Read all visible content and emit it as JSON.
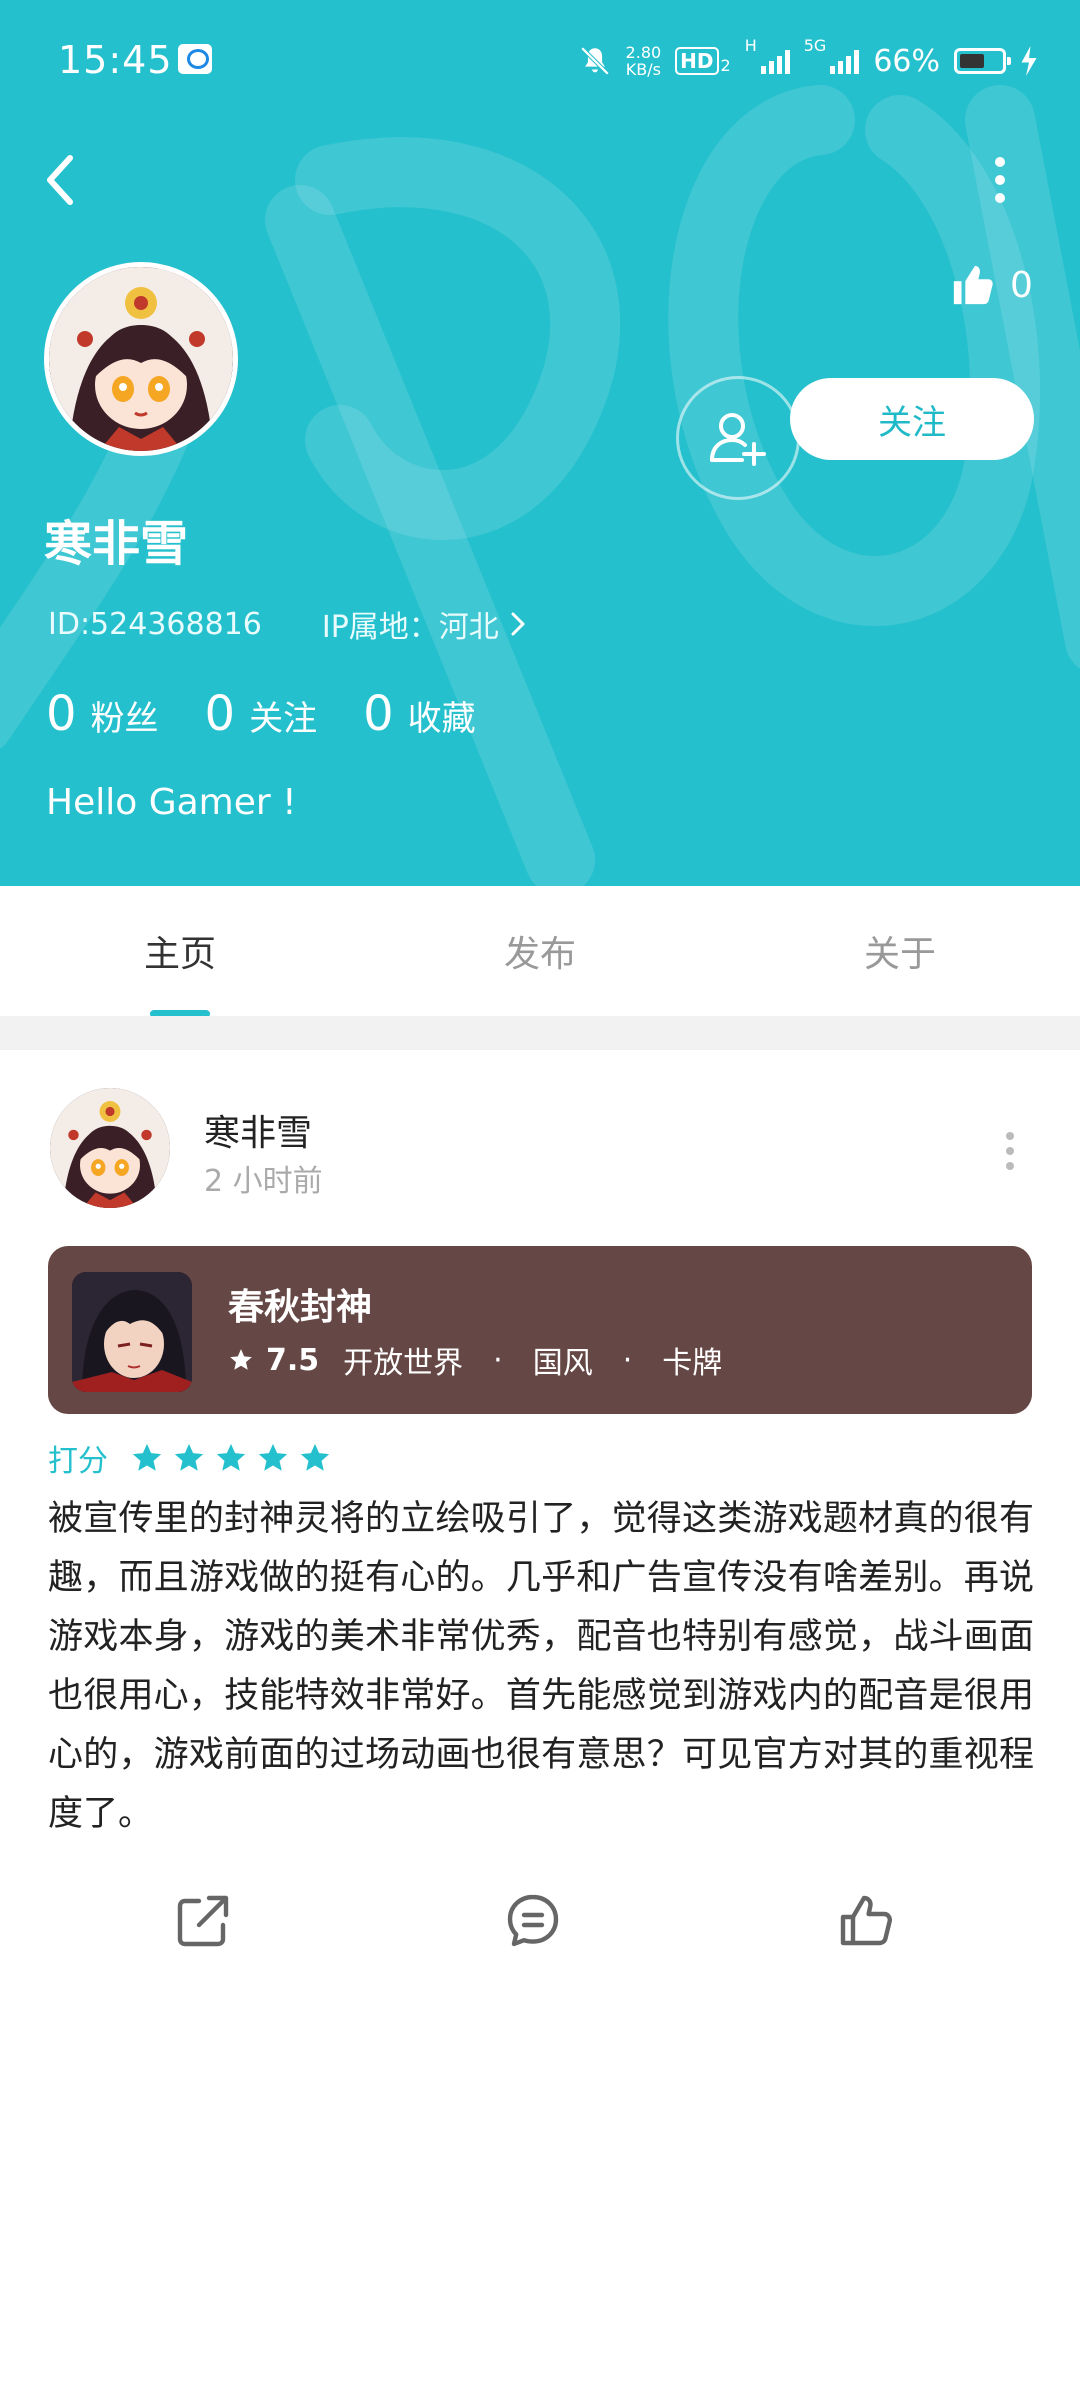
{
  "status_bar": {
    "time": "15:45",
    "net_speed_value": "2.80",
    "net_speed_unit": "KB/s",
    "hd_label": "HD",
    "hd_sub": "2",
    "net_type_1": "H",
    "net_type_2": "5G",
    "battery": "66%"
  },
  "profile": {
    "likes": "0",
    "follow_label": "关注",
    "name": "寒非雪",
    "id": "ID:524368816",
    "ip_location": "IP属地：河北",
    "stats": [
      {
        "value": "0",
        "label": "粉丝"
      },
      {
        "value": "0",
        "label": "关注"
      },
      {
        "value": "0",
        "label": "收藏"
      }
    ],
    "bio": "Hello Gamer !"
  },
  "tabs": [
    {
      "label": "主页",
      "active": true
    },
    {
      "label": "发布",
      "active": false
    },
    {
      "label": "关于",
      "active": false
    }
  ],
  "post": {
    "author": "寒非雪",
    "time": "2 小时前",
    "game": {
      "name": "春秋封神",
      "score": "7.5",
      "tags": [
        "开放世界",
        "国风",
        "卡牌"
      ],
      "tag_separator": "·"
    },
    "rating_label": "打分",
    "rating_stars": 5,
    "review": "被宣传里的封神灵将的立绘吸引了，觉得这类游戏题材真的很有趣，而且游戏做的挺有心的。几乎和广告宣传没有啥差别。再说游戏本身，游戏的美术非常优秀，配音也特别有感觉，战斗画面也很用心，技能特效非常好。首先能感觉到游戏内的配音是很用心的，游戏前面的过场动画也很有意思？可见官方对其的重视程度了。"
  },
  "colors": {
    "accent": "#25c0cd",
    "game_card": "#654845",
    "separator": "#f2f2f2"
  },
  "icons": [
    "back-arrow-icon",
    "more-vertical-icon",
    "thumbs-up-icon",
    "add-user-icon",
    "chevron-right-icon",
    "star-icon",
    "share-icon",
    "comment-icon",
    "like-icon"
  ]
}
